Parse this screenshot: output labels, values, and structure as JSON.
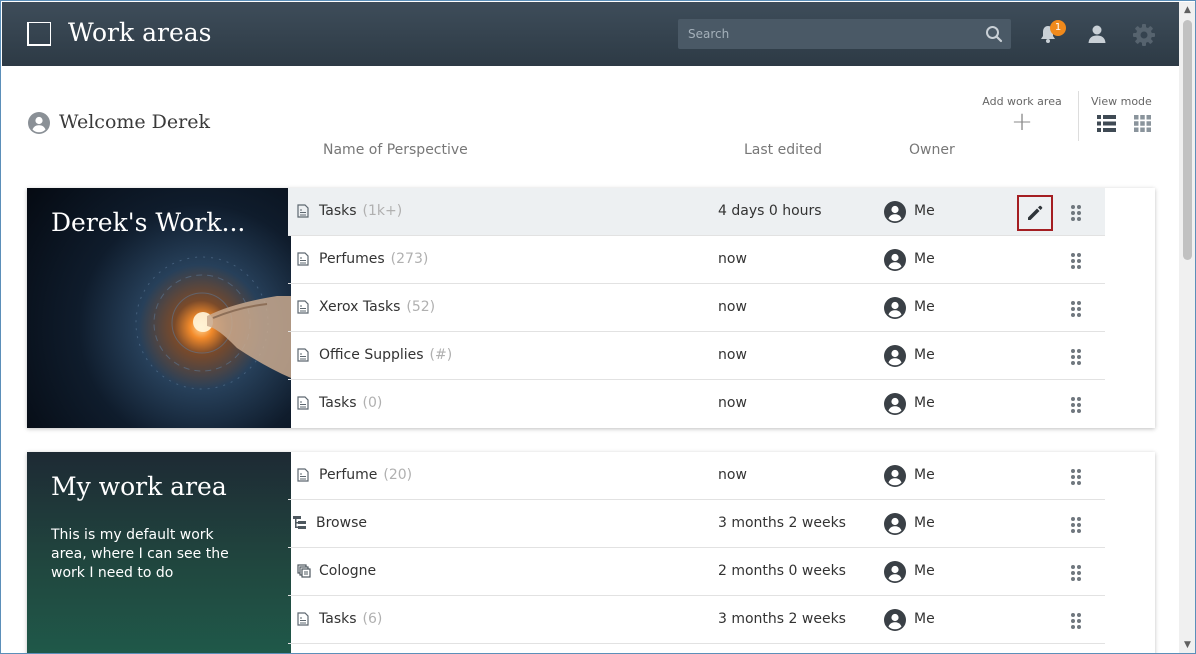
{
  "header": {
    "title": "Work areas",
    "search_placeholder": "Search",
    "notification_count": "1",
    "icons": [
      "app-logo-icon",
      "search-icon",
      "bell-icon",
      "user-icon",
      "gear-icon"
    ]
  },
  "welcome": {
    "text": "Welcome Derek"
  },
  "toolbar": {
    "add_label": "Add work area",
    "add_symbol": "+",
    "view_label": "View mode",
    "view_modes": [
      "list",
      "grid"
    ]
  },
  "columns": {
    "name": "Name of Perspective",
    "edited": "Last edited",
    "owner": "Owner"
  },
  "work_areas": [
    {
      "title": "Derek's Work...",
      "description": "",
      "rows": [
        {
          "icon": "document-icon",
          "name": "Tasks",
          "count": "(1k+)",
          "edited": "4 days 0 hours",
          "owner": "Me",
          "selected": true
        },
        {
          "icon": "document-icon",
          "name": "Perfumes",
          "count": "(273)",
          "edited": "now",
          "owner": "Me"
        },
        {
          "icon": "document-icon",
          "name": "Xerox Tasks",
          "count": "(52)",
          "edited": "now",
          "owner": "Me"
        },
        {
          "icon": "document-icon",
          "name": "Office Supplies",
          "count": "(#)",
          "edited": "now",
          "owner": "Me"
        },
        {
          "icon": "document-icon",
          "name": "Tasks",
          "count": "(0)",
          "edited": "now",
          "owner": "Me"
        }
      ]
    },
    {
      "title": "My work area",
      "description": "This is my default work area, where I can see the work I need to do",
      "rows": [
        {
          "icon": "document-icon",
          "name": "Perfume",
          "count": "(20)",
          "edited": "now",
          "owner": "Me"
        },
        {
          "icon": "hierarchy-icon",
          "name": "Browse",
          "count": "",
          "edited": "3 months 2 weeks",
          "owner": "Me"
        },
        {
          "icon": "collection-icon",
          "name": "Cologne",
          "count": "",
          "edited": "2 months 0 weeks",
          "owner": "Me"
        },
        {
          "icon": "document-icon",
          "name": "Tasks",
          "count": "(6)",
          "edited": "3 months 2 weeks",
          "owner": "Me"
        }
      ]
    }
  ],
  "colors": {
    "header_bg": "#35434f",
    "badge": "#f08a1c",
    "edit_highlight": "#a41e22",
    "selected_row": "#edf0f2"
  }
}
